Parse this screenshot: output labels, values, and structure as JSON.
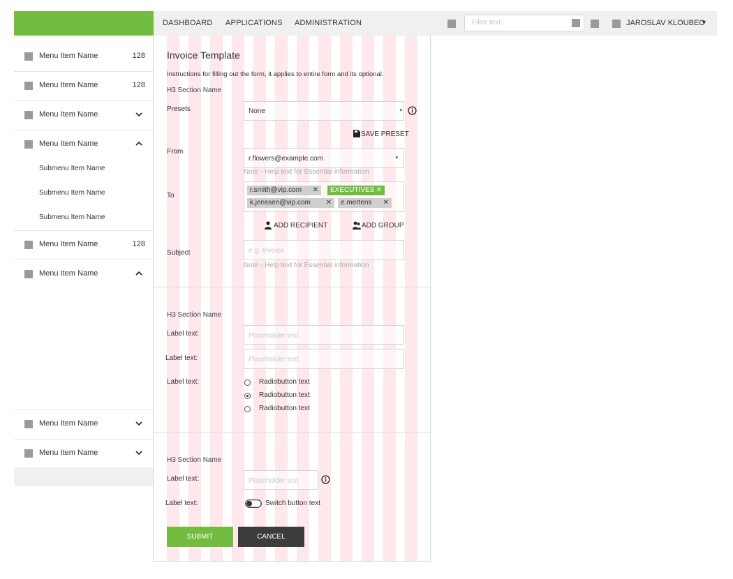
{
  "topnav": {
    "links": [
      "DASHBOARD",
      "APPLICATIONS",
      "ADMINISTRATION"
    ],
    "filter_placeholder": "Filter text",
    "user": "JAROSLAV KLOUBEC",
    "user_caret": "▼"
  },
  "sidebar": {
    "items": [
      {
        "label": "Menu Item Name",
        "count": "128"
      },
      {
        "label": "Menu Item Name",
        "count": "128"
      },
      {
        "label": "Menu Item Name",
        "chevron": "down"
      },
      {
        "label": "Menu Item Name",
        "chevron": "up"
      },
      {
        "label": "Menu Item Name",
        "count": "128"
      },
      {
        "label": "Menu Item Name",
        "chevron": "up"
      },
      {
        "label": "Menu Item Name",
        "chevron": "down"
      },
      {
        "label": "Menu Item Name",
        "chevron": "down"
      }
    ],
    "subitems": [
      "Submenu Item Name",
      "Submenu Item Name",
      "Submenu Item Name"
    ]
  },
  "form": {
    "title": "Invoice Template",
    "instructions": "Instructions for filling out the form, it applies to entire form and its optional.",
    "section1": {
      "heading": "H3 Section Name",
      "presets_label": "Presets",
      "presets_value": "None",
      "save_preset": "SAVE PRESET",
      "from_label": "From",
      "from_value": "r.flowers@example.com",
      "from_help": "Note - Help text for Essential information",
      "to_label": "To",
      "to_tags": [
        {
          "text": "r.smith@vip.com"
        },
        {
          "text": "EXECUTIVES"
        },
        {
          "text": "k.jenssen@vip.com"
        },
        {
          "text": "e.mertens"
        }
      ],
      "add_recipient": "ADD RECIPIENT",
      "add_group": "ADD GROUP",
      "subject_label": "Subject",
      "subject_placeholder": "e.g. Invoice",
      "subject_help": "Note - Help text for Essential information"
    },
    "section2": {
      "heading": "H3 Section Name",
      "label1": "Label text:",
      "input1_placeholder": "Placeholder text",
      "label2": "Label text:",
      "input2_placeholder": "Placeholder text",
      "label3": "Label text:",
      "radios": [
        "Radiobutton text",
        "Radiobutton text",
        "Radiobutton text"
      ],
      "radio_selected": 1
    },
    "section3": {
      "heading": "H3 Section Name",
      "label1": "Label text:",
      "input1_placeholder": "Placeholder text",
      "label2": "Label text:",
      "switch_text": "Switch button text"
    },
    "submit_label": "SUBMIT",
    "cancel_label": "CANCEL"
  },
  "colors": {
    "accent": "#72bd3f",
    "cancel_bg": "#3c3c3c",
    "grid_overlay": "#ffcdd2"
  }
}
